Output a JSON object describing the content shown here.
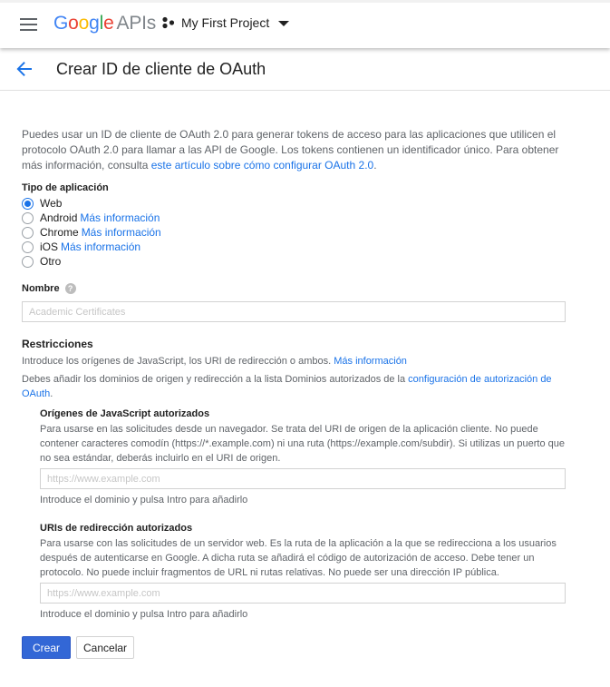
{
  "header": {
    "logo_google": "Google",
    "logo_apis": "APIs",
    "project_name": "My First Project",
    "brand_colors": [
      "#4285f4",
      "#ea4335",
      "#fbbc05",
      "#4285f4",
      "#34a853",
      "#ea4335"
    ]
  },
  "page": {
    "title": "Crear ID de cliente de OAuth"
  },
  "intro": {
    "text": "Puedes usar un ID de cliente de OAuth 2.0 para generar tokens de acceso para las aplicaciones que utilicen el protocolo OAuth 2.0 para llamar a las API de Google. Los tokens contienen un identificador único. Para obtener más información, consulta ",
    "link": "este artículo sobre cómo configurar OAuth 2.0",
    "suffix": "."
  },
  "app_type": {
    "label": "Tipo de aplicación",
    "options": [
      {
        "label": "Web",
        "link": "",
        "checked": true
      },
      {
        "label": "Android",
        "link": "Más información",
        "checked": false
      },
      {
        "label": "Chrome",
        "link": "Más información",
        "checked": false
      },
      {
        "label": "iOS",
        "link": "Más información",
        "checked": false
      },
      {
        "label": "Otro",
        "link": "",
        "checked": false
      }
    ]
  },
  "name": {
    "label": "Nombre",
    "help_icon": "help-icon",
    "placeholder": "Academic Certificates"
  },
  "restrictions": {
    "title": "Restricciones",
    "line1": "Introduce los orígenes de JavaScript, los URI de redirección o ambos.",
    "line1_link": "Más información",
    "line2": "Debes añadir los dominios de origen y redirección a la lista Dominios autorizados de la ",
    "line2_link": "configuración de autorización de OAuth",
    "line2_suffix": ".",
    "js_origins": {
      "title": "Orígenes de JavaScript autorizados",
      "description": "Para usarse en las solicitudes desde un navegador. Se trata del URI de origen de la aplicación cliente. No puede contener caracteres comodín (https://*.example.com) ni una ruta (https://example.com/subdir). Si utilizas un puerto que no sea estándar, deberás incluirlo en el URI de origen.",
      "placeholder": "https://www.example.com",
      "hint": "Introduce el dominio y pulsa Intro para añadirlo"
    },
    "redirect_uris": {
      "title": "URIs de redirección autorizados",
      "description": "Para usarse con las solicitudes de un servidor web. Es la ruta de la aplicación a la que se redirecciona a los usuarios después de autenticarse en Google. A dicha ruta se añadirá el código de autorización de acceso. Debe tener un protocolo. No puede incluir fragmentos de URL ni rutas relativas. No puede ser una dirección IP pública.",
      "placeholder": "https://www.example.com",
      "hint": "Introduce el dominio y pulsa Intro para añadirlo"
    }
  },
  "actions": {
    "create": "Crear",
    "cancel": "Cancelar"
  },
  "colors": {
    "accent": "#1a73e8",
    "primary_button": "#3367d6"
  }
}
